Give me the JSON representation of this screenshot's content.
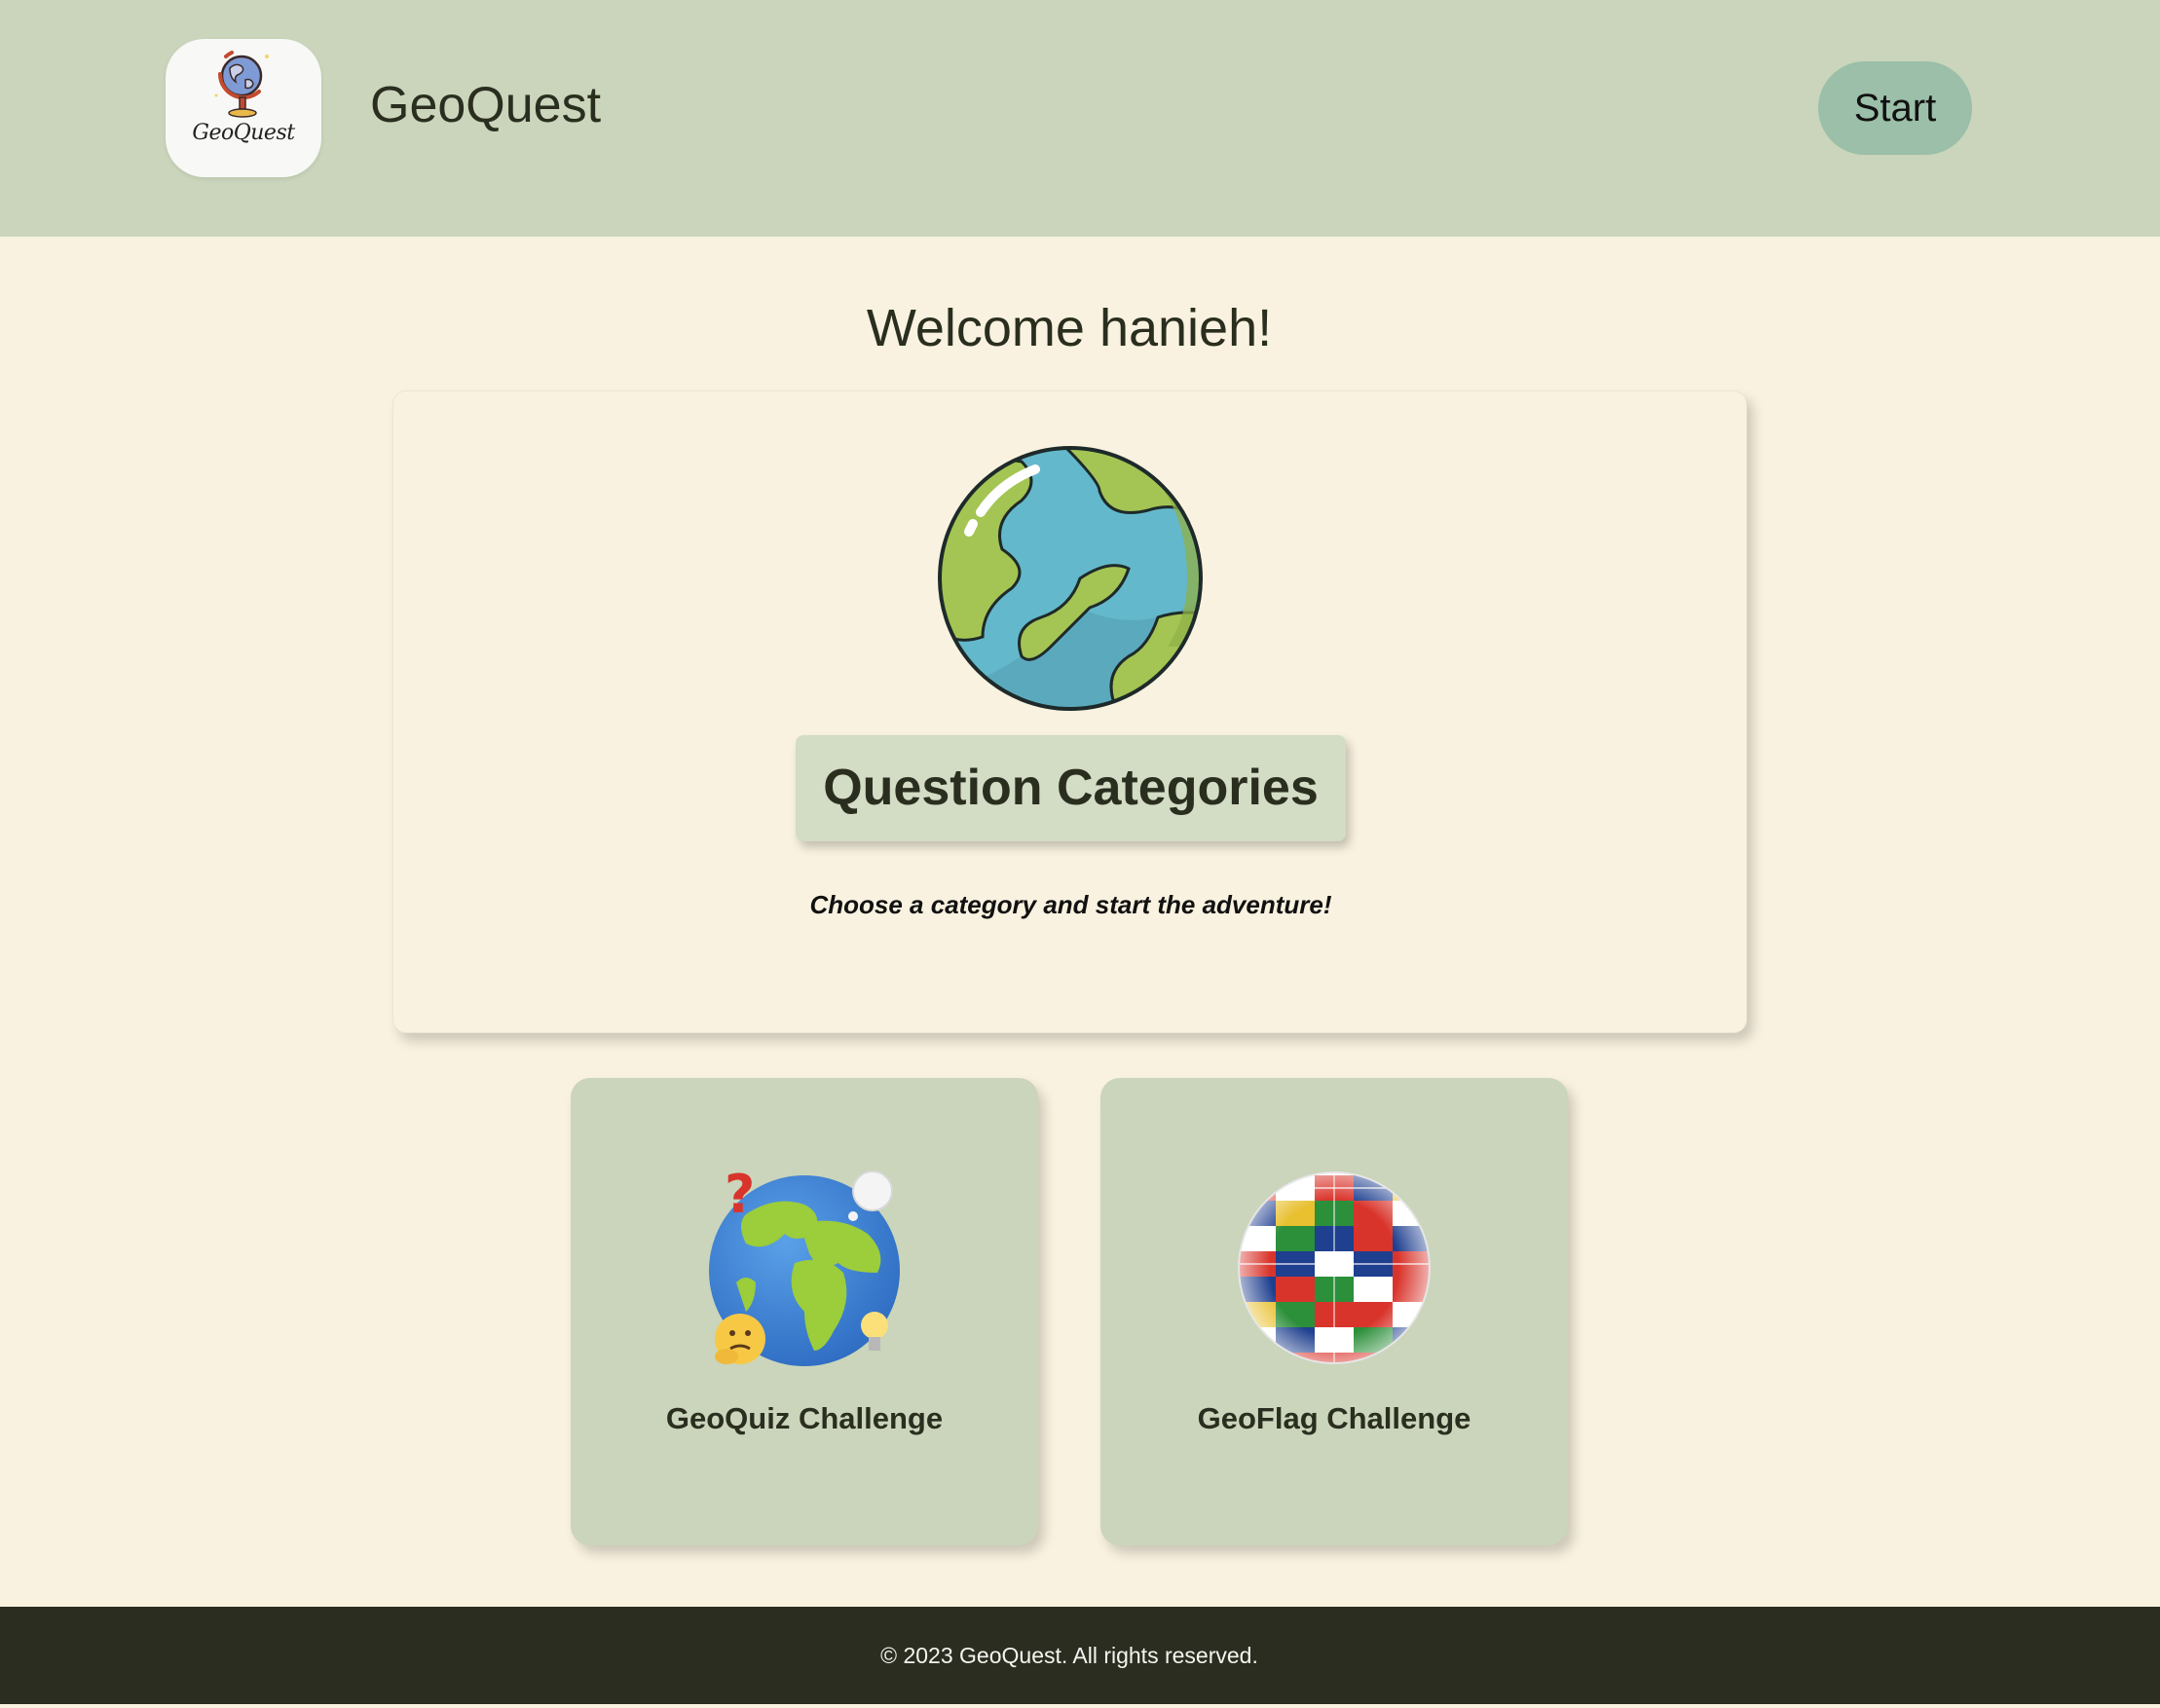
{
  "header": {
    "logo_text": "GeoQuest",
    "app_title": "GeoQuest",
    "start_label": "Start"
  },
  "welcome": {
    "text": "Welcome hanieh!"
  },
  "main_card": {
    "illustration": "earth-globe-icon",
    "heading": "Question Categories",
    "subtitle": "Choose a category and start the adventure!"
  },
  "categories": [
    {
      "label": "GeoQuiz Challenge",
      "icon": "thinking-earth-icon"
    },
    {
      "label": "GeoFlag Challenge",
      "icon": "flag-globe-icon"
    }
  ],
  "footer": {
    "text": "© 2023 GeoQuest. All rights reserved."
  },
  "colors": {
    "header_bg": "#cad5bb",
    "page_bg": "#f9f2e0",
    "start_button": "#9bbfa8",
    "heading_bg": "#d3dcc4",
    "card_bg": "#cad5bb",
    "footer_bg": "#2a2d1f",
    "text": "#2a2e1f"
  }
}
